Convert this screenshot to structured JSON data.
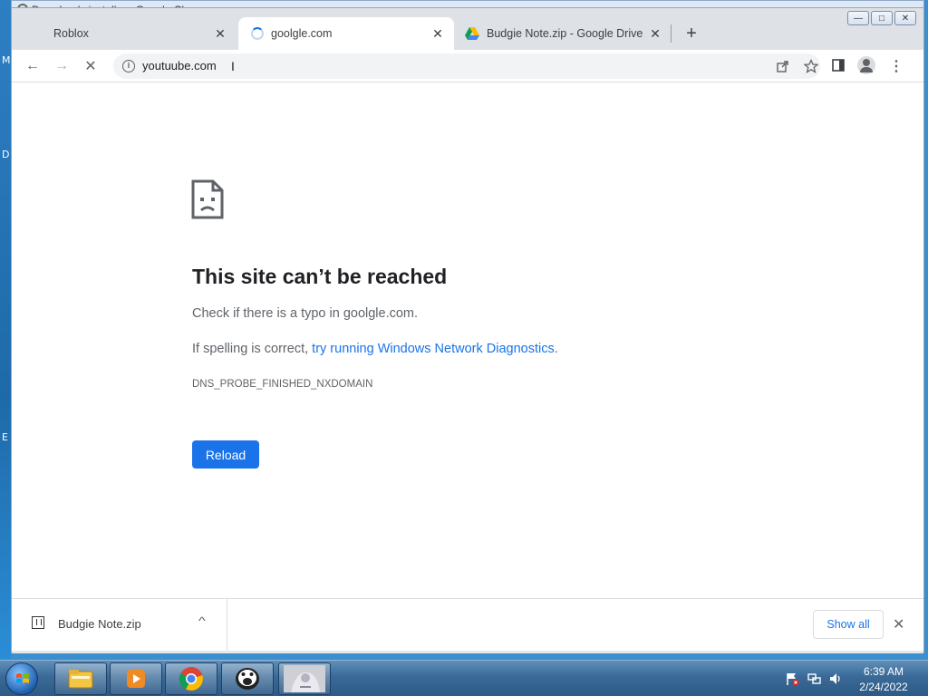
{
  "desktop": {
    "left_letters": [
      "D",
      "M",
      "E"
    ]
  },
  "background_window": {
    "title": "Downloads installer - Google Chrome"
  },
  "window_controls": {
    "minimize": "—",
    "maximize": "□",
    "close": "✕"
  },
  "tabs": [
    {
      "label": "Roblox",
      "close": "✕",
      "active": false
    },
    {
      "label": "goolgle.com",
      "close": "✕",
      "active": true,
      "loading": true
    },
    {
      "label": "Budgie Note.zip - Google Drive",
      "close": "✕",
      "active": false,
      "icon": "google-drive-icon"
    }
  ],
  "new_tab": "+",
  "toolbar": {
    "back": "←",
    "forward": "→",
    "stop": "✕",
    "url": "youtuube.com",
    "share_icon": "share-icon",
    "star_icon": "star-icon",
    "side_panel_icon": "side-panel-icon",
    "profile_icon": "profile-icon",
    "menu": "⋮"
  },
  "error_page": {
    "title": "This site can’t be reached",
    "line1": "Check if there is a typo in goolgle.com.",
    "line2_prefix": "If spelling is correct, ",
    "line2_link": "try running Windows Network Diagnostics",
    "line2_suffix": ".",
    "code": "DNS_PROBE_FINISHED_NXDOMAIN",
    "reload": "Reload"
  },
  "download_shelf": {
    "file_name": "Budgie Note.zip",
    "chevron": "^",
    "show_all": "Show all",
    "close": "✕"
  },
  "taskbar": {
    "apps": [
      "file-explorer-icon",
      "media-player-icon",
      "chrome-icon",
      "shocked-face-icon",
      "image-thumbnail-icon"
    ],
    "time": "6:39 AM",
    "date": "2/24/2022"
  },
  "colors": {
    "accent": "#1a73e8",
    "title": "#202124",
    "text_secondary": "#5f6368",
    "tabstrip": "#dee1e6"
  }
}
